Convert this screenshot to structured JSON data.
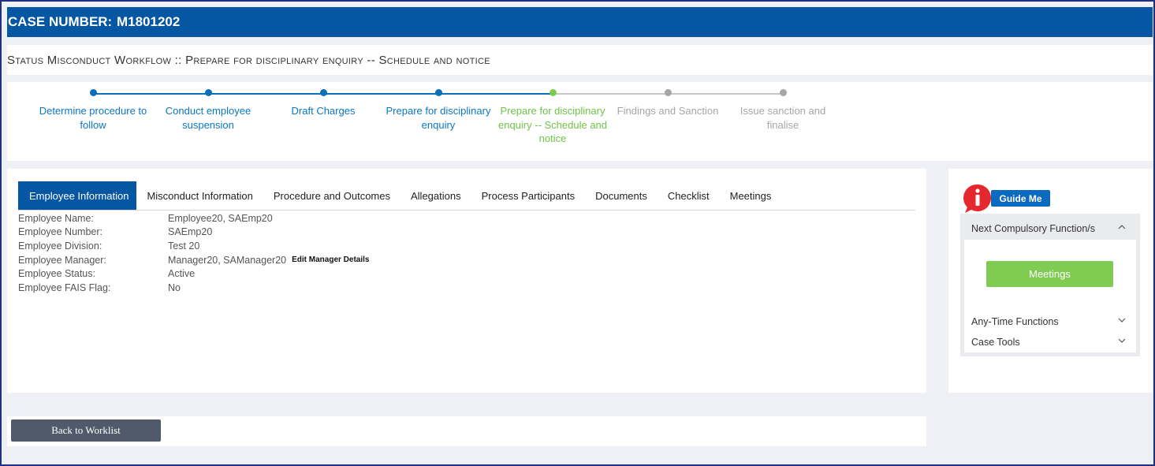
{
  "case": {
    "label": "CASE NUMBER:",
    "number": "M1801202"
  },
  "status": {
    "title": "Status Misconduct Workflow :: Prepare for disciplinary enquiry -- Schedule and notice"
  },
  "steps": [
    {
      "label": "Determine procedure to follow",
      "state": "done"
    },
    {
      "label": "Conduct employee suspension",
      "state": "done"
    },
    {
      "label": "Draft Charges",
      "state": "done"
    },
    {
      "label": "Prepare for disciplinary enquiry",
      "state": "done"
    },
    {
      "label": "Prepare for disciplinary enquiry -- Schedule and notice",
      "state": "current"
    },
    {
      "label": "Findings and Sanction",
      "state": "todo"
    },
    {
      "label": "Issue sanction and finalise",
      "state": "todo"
    }
  ],
  "tabs": [
    {
      "label": "Employee Information",
      "active": true
    },
    {
      "label": "Misconduct Information"
    },
    {
      "label": "Procedure and Outcomes"
    },
    {
      "label": "Allegations"
    },
    {
      "label": "Process Participants"
    },
    {
      "label": "Documents"
    },
    {
      "label": "Checklist"
    },
    {
      "label": "Meetings"
    }
  ],
  "employee": {
    "rows": [
      {
        "key": "Employee Name:",
        "value": "Employee20, SAEmp20"
      },
      {
        "key": "Employee Number:",
        "value": "SAEmp20"
      },
      {
        "key": "Employee Division:",
        "value": "Test 20"
      },
      {
        "key": "Employee Manager:",
        "value": "Manager20, SAManager20"
      },
      {
        "key": "Employee Status:",
        "value": "Active"
      },
      {
        "key": "Employee FAIS Flag:",
        "value": "No"
      }
    ],
    "edit_manager_label": "Edit Manager Details"
  },
  "footer": {
    "back_label": "Back to Worklist"
  },
  "sidebar": {
    "guide_label": "Guide Me",
    "next_compulsory_label": "Next Compulsory Function/s",
    "meetings_button": "Meetings",
    "any_time_label": "Any-Time Functions",
    "case_tools_label": "Case Tools"
  },
  "colors": {
    "header_blue": "#0556a3",
    "step_done": "#0b77c2",
    "step_current": "#6fc349",
    "step_todo": "#a6a6a6",
    "meetings_green": "#80cc52",
    "back_button": "#505a6a"
  }
}
